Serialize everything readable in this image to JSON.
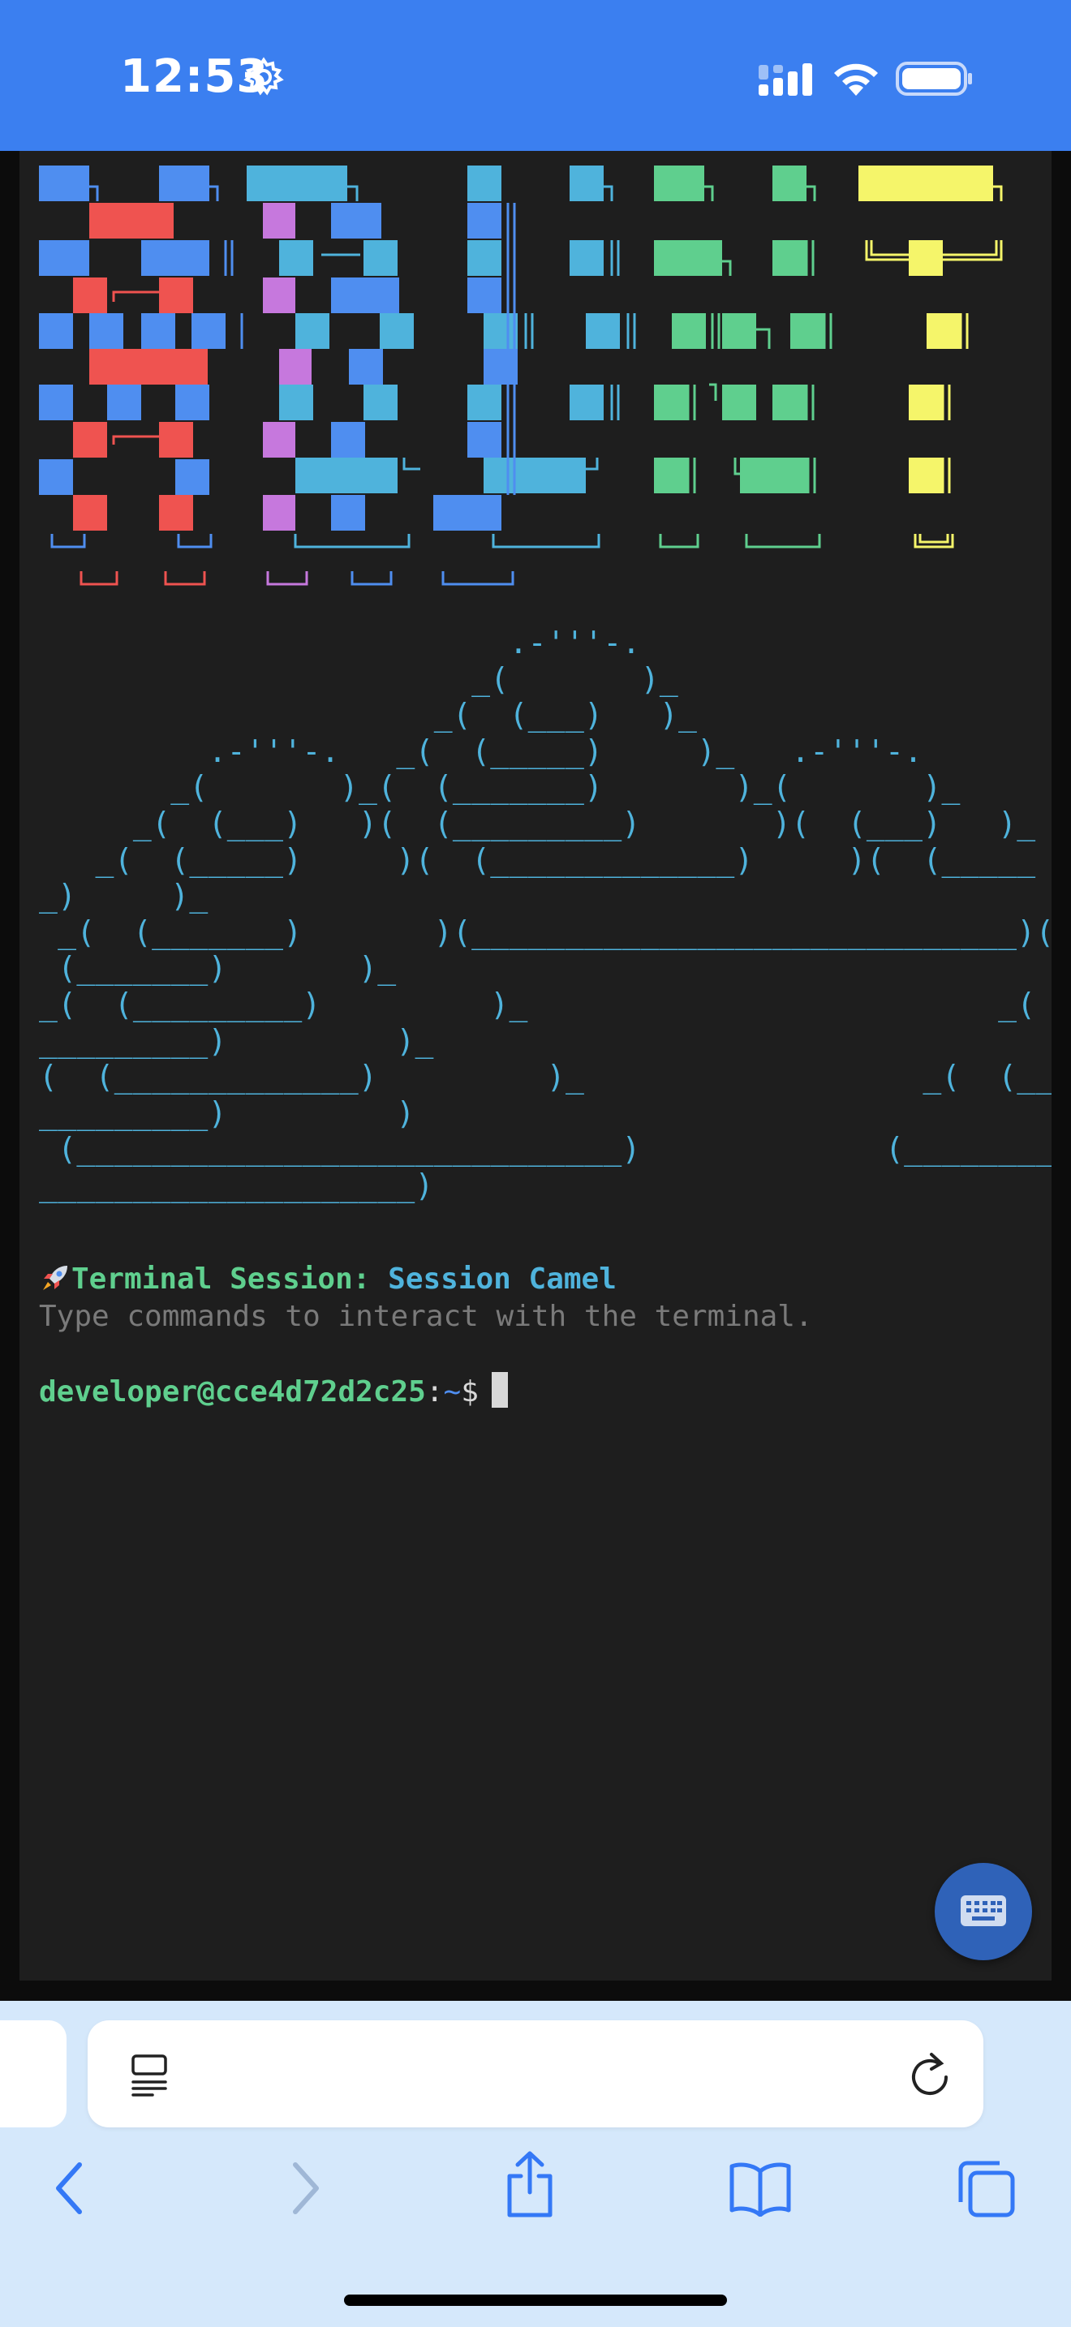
{
  "status_bar": {
    "time": "12:53",
    "icons": [
      "gear-icon",
      "cellular-signal-icon",
      "wifi-icon",
      "battery-icon"
    ]
  },
  "terminal": {
    "banner": {
      "text": "SESSION",
      "style": "ANSI Shadow block letters",
      "letter_colors": [
        "#ef5350",
        "#c678dd",
        "#4f8ef0",
        "#4fb3dc",
        "#5fcf8e",
        "#f5f56a"
      ]
    },
    "ascii_art_description_colors": {
      "outline": "#4fb3dc",
      "fill": "#ffffff"
    },
    "ascii_art_lines": [
      "                         .-'''-.",
      "                       _(       )_",
      "                     _(  (___)   )_",
      "         .-'''-.   _(  (_____)     )_   .-'''-.",
      "       _(       )_(  (_______)       )_(       )_",
      "     _(  (___)   )(  (_________)       )(  (___)   )_",
      "   _(  (_____)     )(  (_____________)     )(  (_____",
      "_)     )_",
      " _(  (_______)       )(_____________________________)(",
      " (_______)       )_",
      "_(  (_________)         )_                         _(  (_",
      "_________)         )_",
      "(  (_____________)         )_                  _(  (_____",
      "_________)         )",
      " (_____________________________)             (__________",
      "____________________)"
    ],
    "session_title_prefix": "Terminal Session: ",
    "session_name": "Session Camel",
    "session_icon": "rocket-icon",
    "hint": "Type commands to interact with the terminal.",
    "prompt": {
      "user_host": "developer@cce4d72d2c25",
      "separator": ":",
      "path": "~",
      "symbol": "$"
    },
    "colors": {
      "background": "#1e1e1e",
      "green": "#5fcf8e",
      "cyan": "#4fb3dc",
      "blue": "#4f8ef0",
      "gray": "#7a7a7a"
    }
  },
  "keyboard_button": {
    "icon": "keyboard-icon"
  },
  "browser_toolbar": {
    "address_icons": [
      "page-menu-icon",
      "reload-icon"
    ],
    "nav_icons": [
      "back-icon",
      "forward-icon",
      "share-icon",
      "bookmarks-icon",
      "tabs-icon"
    ]
  }
}
